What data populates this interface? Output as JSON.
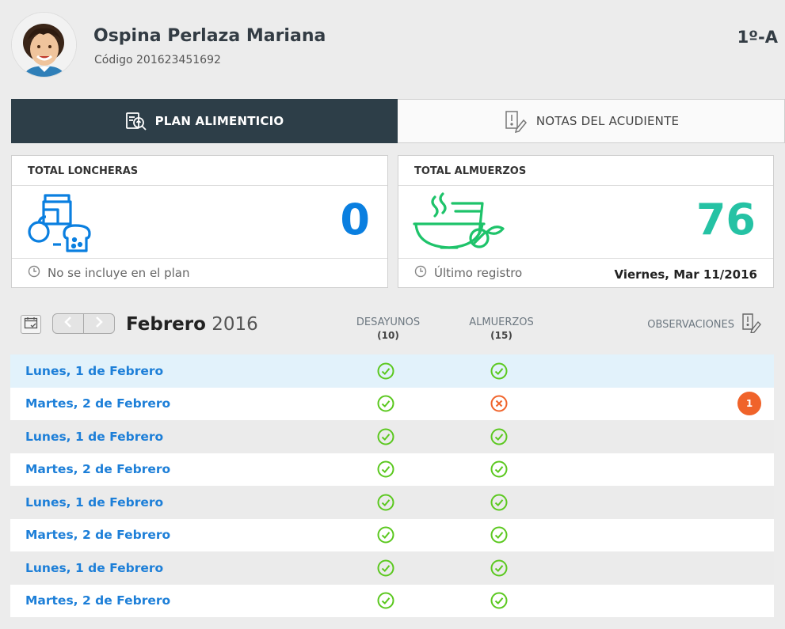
{
  "student": {
    "name": "Ospina Perlaza Mariana",
    "code": "Código 201623451692",
    "grade": "1º-A"
  },
  "tabs": [
    {
      "label": "PLAN ALIMENTICIO",
      "active": true,
      "icon": "meal-plan-icon"
    },
    {
      "label": "NOTAS DEL ACUDIENTE",
      "active": false,
      "icon": "note-edit-icon"
    }
  ],
  "cards": {
    "loncheras": {
      "title": "TOTAL LONCHERAS",
      "value": "0",
      "foot": "No se incluye en el plan",
      "icon": "lunchbox-icon",
      "color": "#0a7fe0"
    },
    "almuerzos": {
      "title": "TOTAL ALMUERZOS",
      "value": "76",
      "foot": "Último registro",
      "foot_right": "Viernes, Mar 11/2016",
      "icon": "meal-bowl-icon",
      "color": "#25c2a4"
    }
  },
  "month": {
    "name": "Febrero",
    "year": "2016"
  },
  "columns": {
    "desayunos": {
      "label": "DESAYUNOS",
      "count": "(10)"
    },
    "almuerzos": {
      "label": "ALMUERZOS",
      "count": "(15)"
    },
    "observaciones": {
      "label": "OBSERVACIONES"
    }
  },
  "rows": [
    {
      "date": "Lunes, 1 de Febrero",
      "desayuno": "check",
      "almuerzo": "check",
      "badge": ""
    },
    {
      "date": "Martes, 2 de Febrero",
      "desayuno": "check",
      "almuerzo": "cross",
      "badge": "1"
    },
    {
      "date": "Lunes, 1 de Febrero",
      "desayuno": "check",
      "almuerzo": "check",
      "badge": ""
    },
    {
      "date": "Martes, 2 de Febrero",
      "desayuno": "check",
      "almuerzo": "check",
      "badge": ""
    },
    {
      "date": "Lunes, 1 de Febrero",
      "desayuno": "check",
      "almuerzo": "check",
      "badge": ""
    },
    {
      "date": "Martes, 2 de Febrero",
      "desayuno": "check",
      "almuerzo": "check",
      "badge": ""
    },
    {
      "date": "Lunes, 1 de Febrero",
      "desayuno": "check",
      "almuerzo": "check",
      "badge": ""
    },
    {
      "date": "Martes, 2 de Febrero",
      "desayuno": "check",
      "almuerzo": "check",
      "badge": ""
    }
  ],
  "colors": {
    "check": "#5bc81f",
    "cross": "#f0632a",
    "badge": "#f0632a",
    "link": "#1d7fd8",
    "tab_active": "#2d3e48"
  }
}
